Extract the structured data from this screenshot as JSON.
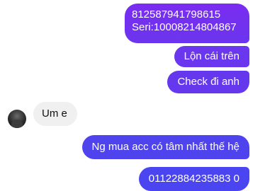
{
  "messages": {
    "m1_line1": "812587941798615",
    "m1_line2": "Seri:10008214804867",
    "m2": "Lộn cái trên",
    "m3": "Check đi anh",
    "m4": "Um e",
    "m5": "Ng mua acc có tâm nhất thế hệ",
    "m6": "01122884235883 0"
  },
  "colors": {
    "outgoing_top": "#7a2cf0",
    "outgoing_bottom": "#4a45f0",
    "incoming_bg": "#f0f0f0"
  }
}
